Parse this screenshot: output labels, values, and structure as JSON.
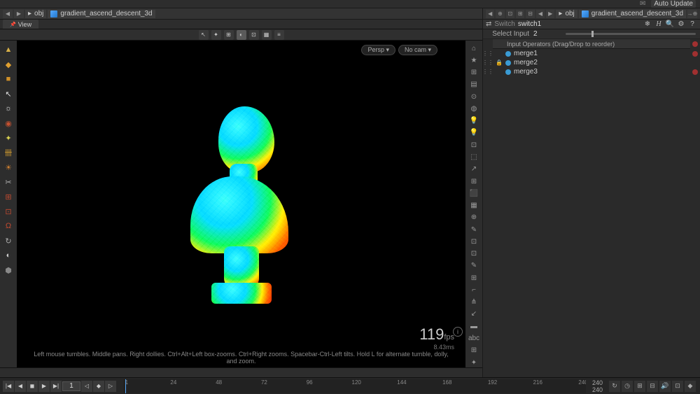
{
  "topbar": {
    "send": "✉",
    "auto": "Auto Update"
  },
  "left": {
    "nav": {
      "obj": "obj",
      "file": "gradient_ascend_descent_3d"
    },
    "viewTab": "View",
    "viewTools": [
      "↖",
      "✦",
      "⊞",
      "◐",
      "⊡",
      "▦",
      "≡"
    ],
    "shelf": [
      {
        "glyph": "▲",
        "color": "#d8b048"
      },
      {
        "glyph": "◆",
        "color": "#e0a030"
      },
      {
        "glyph": "■",
        "color": "#d09028"
      },
      {
        "glyph": "↖",
        "color": "#e0e0e0"
      },
      {
        "glyph": "☼",
        "color": "#e0e0e0"
      },
      {
        "glyph": "◉",
        "color": "#c35030"
      },
      {
        "glyph": "✦",
        "color": "#d8d050"
      },
      {
        "glyph": "卌",
        "color": "#d8a030"
      },
      {
        "glyph": "☀",
        "color": "#d08030"
      },
      {
        "glyph": "✂",
        "color": "#b0b0b0"
      },
      {
        "glyph": "⊞",
        "color": "#c04a30"
      },
      {
        "glyph": "⊡",
        "color": "#c04a30"
      },
      {
        "glyph": "Ω",
        "color": "#c04a30"
      },
      {
        "glyph": "↻",
        "color": "#aaaaaa"
      },
      {
        "glyph": "◐",
        "color": "#cccccc"
      },
      {
        "glyph": "⬢",
        "color": "#888888"
      }
    ],
    "viewport": {
      "persp": "Persp ▾",
      "cam": "No cam ▾",
      "fps_n": "119",
      "fps_u": "fps",
      "ms": "8.43ms",
      "hint": "Left mouse tumbles. Middle pans. Right dollies. Ctrl+Alt+Left box-zooms. Ctrl+Right zooms. Spacebar-Ctrl-Left tilts. Hold L for alternate tumble, dolly, and zoom."
    },
    "rightShelf": [
      "⌂",
      "★",
      "⊞",
      "▤",
      "⊙",
      "◍",
      "💡",
      "💡",
      "⊡",
      "⬚",
      "↗",
      "⊞",
      "⬛",
      "▦",
      "⊕",
      "✎",
      "⊡",
      "⊡",
      "✎",
      "⊞",
      "⌐",
      "⋔",
      "↙",
      "▬",
      "abc",
      "⊞",
      "✦"
    ]
  },
  "right": {
    "nav": {
      "obj": "obj",
      "file": "gradient_ascend_descent_3d"
    },
    "switch": {
      "label": "Switch",
      "name": "switch1",
      "tools": [
        "❄",
        "H",
        "🔍",
        "⚙",
        "?"
      ]
    },
    "param": {
      "label": "Select Input",
      "value": "2"
    },
    "inputsHdr": "Input Operators (Drag/Drop to reorder)",
    "inputs": [
      {
        "name": "merge1",
        "lock": ""
      },
      {
        "name": "merge2",
        "lock": "🔒"
      },
      {
        "name": "merge3",
        "lock": ""
      }
    ]
  },
  "timeline": {
    "frame": "1",
    "ticks": [
      "1",
      "24",
      "48",
      "72",
      "96",
      "120",
      "144",
      "168",
      "192",
      "216",
      "240"
    ],
    "range1": "240",
    "range2": "240"
  }
}
